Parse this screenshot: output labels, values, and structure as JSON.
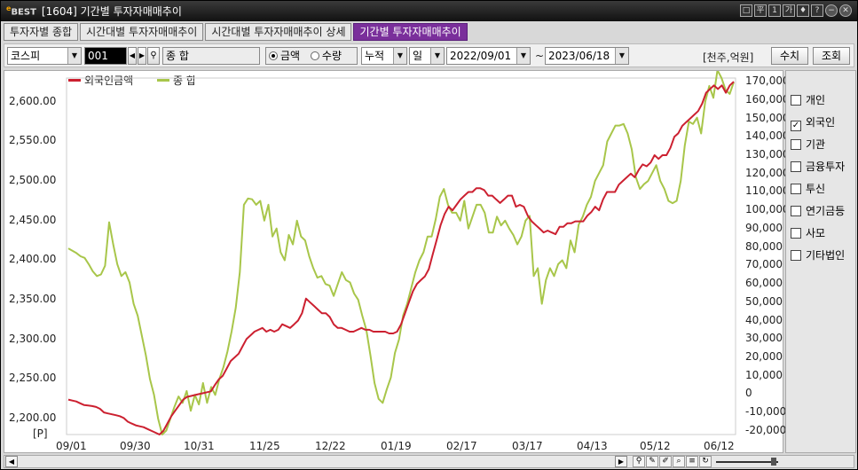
{
  "window": {
    "logo": "BEST",
    "title": "[1604] 기간별 투자자매매추이"
  },
  "title_buttons": [
    "□",
    "平",
    "1",
    "가",
    "♦",
    "?",
    "−",
    "✕"
  ],
  "tabs": [
    {
      "label": "투자자별 종합",
      "active": false
    },
    {
      "label": "시간대별 투자자매매추이",
      "active": false
    },
    {
      "label": "시간대별 투자자매매추이 상세",
      "active": false
    },
    {
      "label": "기간별 투자자매매추이",
      "active": true
    }
  ],
  "toolbar": {
    "market": "코스피",
    "code": "001",
    "name": "종 합",
    "radio_amount": "금액",
    "radio_qty": "수량",
    "cumulative": "누적",
    "period": "일",
    "start_date": "2022/09/01",
    "tilde": "~",
    "end_date": "2023/06/18",
    "unit": "[천주,억원]",
    "value_btn": "수치",
    "query_btn": "조회"
  },
  "side_checks": [
    {
      "label": "개인",
      "checked": false
    },
    {
      "label": "외국인",
      "checked": true
    },
    {
      "label": "기관",
      "checked": false
    },
    {
      "label": "금융투자",
      "checked": false
    },
    {
      "label": "투신",
      "checked": false
    },
    {
      "label": "연기금등",
      "checked": false
    },
    {
      "label": "사모",
      "checked": false
    },
    {
      "label": "기타법인",
      "checked": false
    }
  ],
  "colors": {
    "foreign": "#cc2030",
    "composite": "#a8c64a",
    "tab_active": "#7a2f9b"
  },
  "chart_data": {
    "type": "line",
    "legend": [
      "외국인금액",
      "종 합"
    ],
    "left_unit": "[P]",
    "left_ticks": [
      "2,600.00",
      "2,550.00",
      "2,500.00",
      "2,450.00",
      "2,400.00",
      "2,350.00",
      "2,300.00",
      "2,250.00",
      "2,200.00"
    ],
    "right_ticks": [
      "170,000",
      "160,000",
      "150,000",
      "140,000",
      "130,000",
      "120,000",
      "110,000",
      "100,000",
      "90,000",
      "80,000",
      "70,000",
      "60,000",
      "50,000",
      "40,000",
      "30,000",
      "20,000",
      "10,000",
      "0",
      "-10,000",
      "-20,000"
    ],
    "x_ticks": [
      "09/01",
      "09/30",
      "10/31",
      "11/25",
      "12/22",
      "01/19",
      "02/17",
      "03/17",
      "04/13",
      "05/12",
      "06/12"
    ],
    "ylim_left": [
      2180,
      2630
    ],
    "ylim_right": [
      -22000,
      172000
    ],
    "series": [
      {
        "name": "종 합",
        "axis": "left",
        "values": [
          2415,
          2412,
          2409,
          2405,
          2403,
          2395,
          2386,
          2380,
          2382,
          2393,
          2448,
          2420,
          2395,
          2380,
          2385,
          2372,
          2345,
          2330,
          2305,
          2280,
          2250,
          2230,
          2200,
          2180,
          2185,
          2200,
          2215,
          2228,
          2220,
          2235,
          2210,
          2230,
          2218,
          2245,
          2220,
          2240,
          2230,
          2250,
          2265,
          2285,
          2310,
          2340,
          2385,
          2470,
          2478,
          2477,
          2470,
          2475,
          2450,
          2470,
          2430,
          2440,
          2410,
          2400,
          2432,
          2420,
          2450,
          2430,
          2425,
          2405,
          2390,
          2378,
          2380,
          2370,
          2368,
          2355,
          2370,
          2385,
          2375,
          2372,
          2358,
          2350,
          2330,
          2312,
          2280,
          2245,
          2225,
          2220,
          2237,
          2252,
          2283,
          2300,
          2330,
          2345,
          2365,
          2385,
          2400,
          2410,
          2430,
          2430,
          2452,
          2480,
          2490,
          2470,
          2460,
          2460,
          2450,
          2475,
          2440,
          2455,
          2470,
          2470,
          2460,
          2435,
          2435,
          2455,
          2444,
          2450,
          2440,
          2432,
          2420,
          2430,
          2450,
          2456,
          2380,
          2390,
          2345,
          2375,
          2390,
          2380,
          2395,
          2400,
          2390,
          2425,
          2410,
          2445,
          2455,
          2470,
          2480,
          2500,
          2510,
          2520,
          2550,
          2560,
          2570,
          2570,
          2572,
          2560,
          2540,
          2505,
          2490,
          2496,
          2500,
          2510,
          2520,
          2500,
          2490,
          2475,
          2472,
          2475,
          2500,
          2545,
          2575,
          2572,
          2580,
          2560,
          2600,
          2620,
          2605,
          2640,
          2630,
          2615,
          2610,
          2625
        ]
      },
      {
        "name": "외국인금액",
        "axis": "right",
        "values": [
          -3000,
          -3500,
          -4000,
          -5000,
          -6000,
          -6200,
          -6500,
          -7000,
          -8000,
          -10000,
          -10500,
          -11000,
          -11500,
          -12000,
          -13000,
          -15000,
          -16000,
          -17000,
          -17500,
          -18000,
          -19000,
          -20000,
          -21000,
          -22000,
          -20000,
          -16000,
          -12000,
          -9000,
          -6000,
          -3000,
          -1500,
          -1000,
          -500,
          0,
          500,
          1000,
          1500,
          5000,
          8000,
          10000,
          14000,
          18000,
          20000,
          22000,
          26000,
          30000,
          32000,
          34000,
          35000,
          36000,
          34000,
          35000,
          34000,
          35000,
          38000,
          37000,
          36000,
          38000,
          40000,
          44000,
          52000,
          50000,
          48000,
          46000,
          44000,
          44000,
          42000,
          38000,
          36000,
          36000,
          35000,
          34000,
          34000,
          35000,
          36000,
          35000,
          35000,
          34000,
          34000,
          34000,
          34000,
          33000,
          33000,
          34000,
          38000,
          44000,
          50000,
          56000,
          60000,
          62000,
          64000,
          68000,
          76000,
          84000,
          92000,
          98000,
          102000,
          100000,
          103000,
          106000,
          108000,
          110000,
          110000,
          112000,
          112000,
          111000,
          108000,
          108000,
          106000,
          104000,
          106000,
          108000,
          108000,
          102000,
          103000,
          102000,
          97000,
          94000,
          92000,
          90000,
          88000,
          89000,
          88000,
          87000,
          91000,
          91000,
          93000,
          93000,
          94000,
          94000,
          94000,
          97000,
          99000,
          102000,
          100000,
          106000,
          110000,
          110000,
          110000,
          114000,
          116000,
          118000,
          120000,
          118000,
          122000,
          125000,
          124000,
          126000,
          130000,
          128000,
          130000,
          130000,
          134000,
          140000,
          142000,
          146000,
          148000,
          150000,
          152000,
          154000,
          158000,
          164000,
          166000,
          168000,
          166000,
          168000,
          164000,
          168000,
          170000
        ]
      }
    ]
  }
}
